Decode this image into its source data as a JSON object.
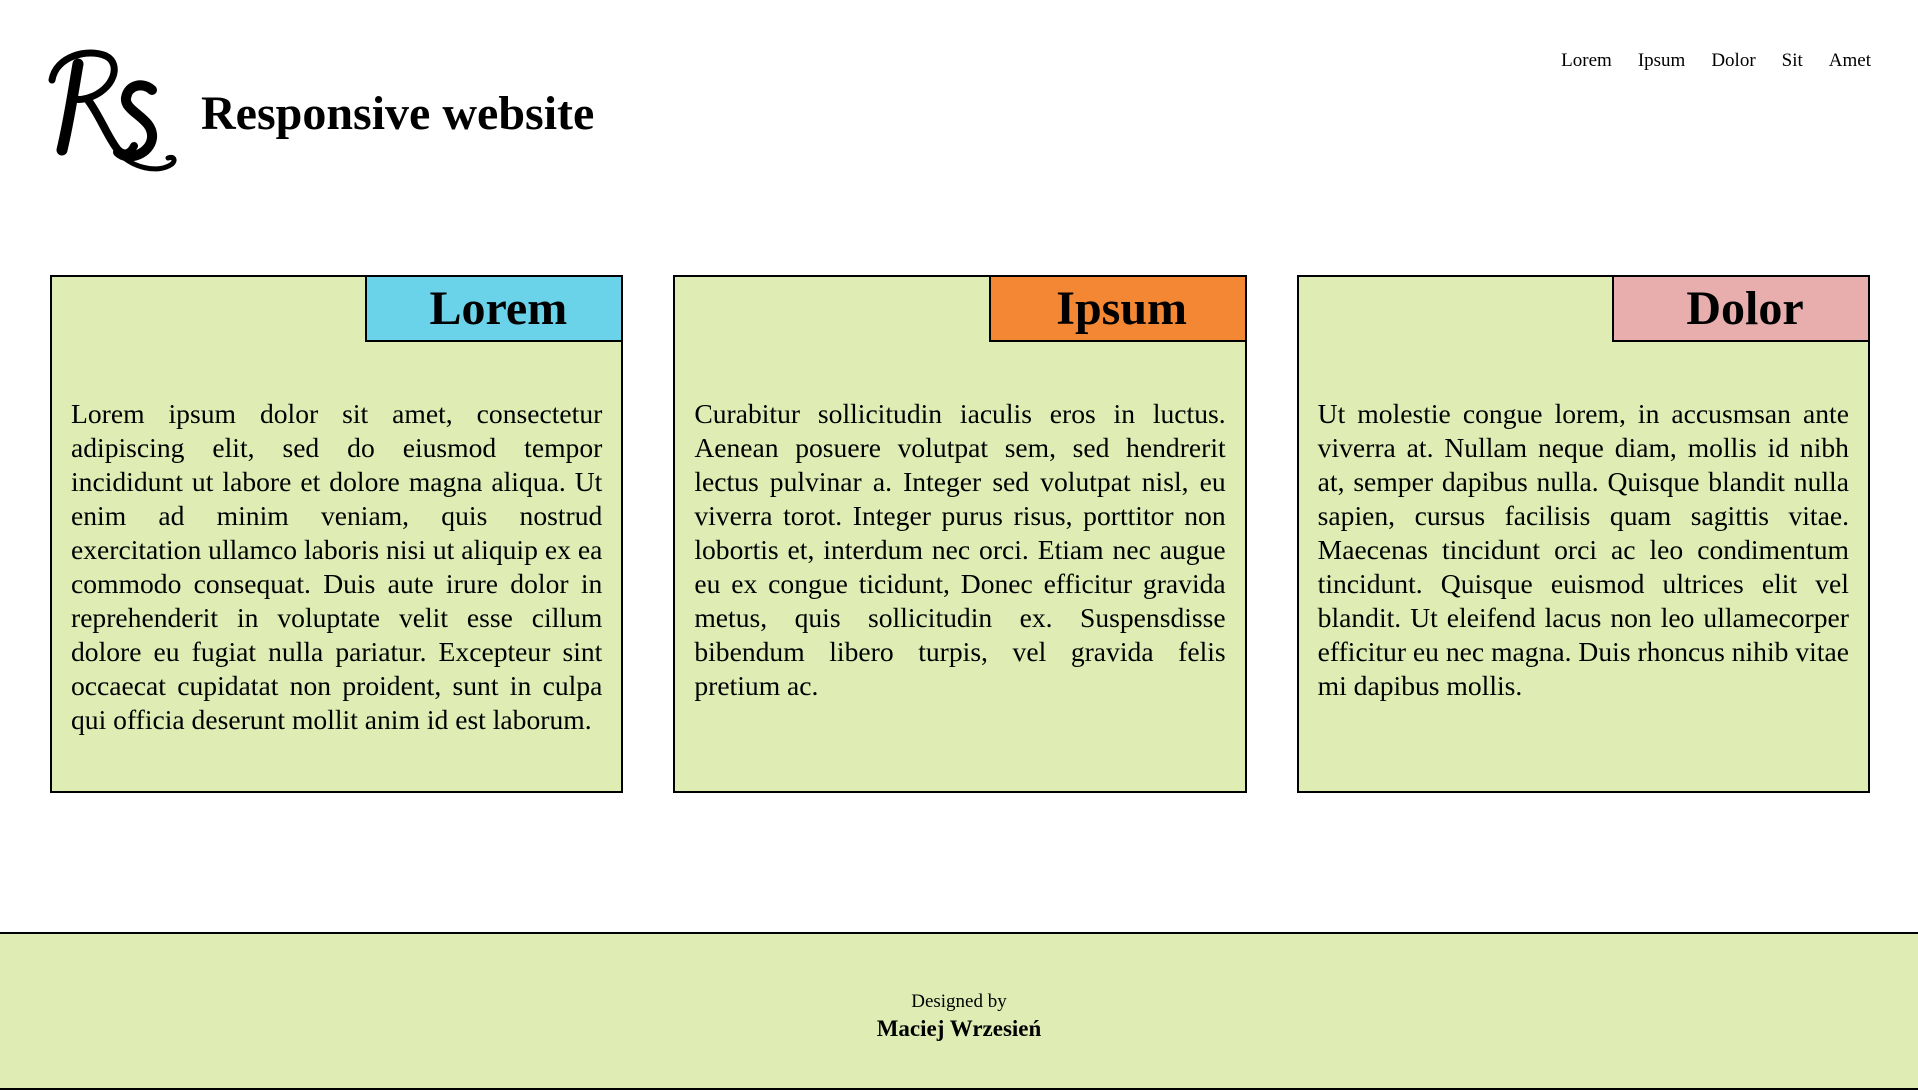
{
  "header": {
    "logo_text": "RS",
    "title": "Responsive website"
  },
  "nav": {
    "items": [
      "Lorem",
      "Ipsum",
      "Dolor",
      "Sit",
      "Amet"
    ]
  },
  "colors": {
    "card_background": "#dfedb5",
    "footer_background": "#dfedb5",
    "tag_lorem": "#6ad3ea",
    "tag_ipsum": "#f48734",
    "tag_dolor": "#e8adad",
    "border": "#000000"
  },
  "cards": [
    {
      "title": "Lorem",
      "text": "Lorem ipsum dolor sit amet, consectetur adipiscing elit, sed do eiusmod tempor incididunt ut labore et dolore magna aliqua. Ut enim ad minim veniam, quis nostrud exercitation ullamco laboris nisi ut aliquip ex ea commodo consequat. Duis aute irure dolor in reprehenderit in voluptate velit esse cillum dolore eu fugiat nulla pariatur. Excepteur sint occaecat cupidatat non proident, sunt in culpa qui officia deserunt mollit anim id est laborum."
    },
    {
      "title": "Ipsum",
      "text": "Curabitur sollicitudin iaculis eros in luctus. Aenean posuere volutpat sem, sed hendrerit lectus pulvinar a. Integer sed volutpat nisl, eu viverra torot. Integer purus risus, porttitor non lobortis et, interdum nec orci. Etiam nec augue eu ex congue ticidunt, Donec efficitur gravida metus, quis sollicitudin ex. Suspensdisse bibendum libero turpis, vel gravida felis pretium ac."
    },
    {
      "title": "Dolor",
      "text": "Ut molestie congue lorem, in accusmsan ante viverra at. Nullam neque diam, mollis id nibh at, semper dapibus nulla. Quisque blandit nulla sapien, cursus facilisis quam sagittis vitae. Maecenas tincidunt orci ac leo condimentum tincidunt. Quisque euismod ultrices elit vel blandit. Ut eleifend lacus non leo ullamecorper efficitur eu nec magna. Duis rhoncus nihib vitae mi dapibus mollis."
    }
  ],
  "footer": {
    "designed_by": "Designed by",
    "author": "Maciej Wrzesień"
  }
}
